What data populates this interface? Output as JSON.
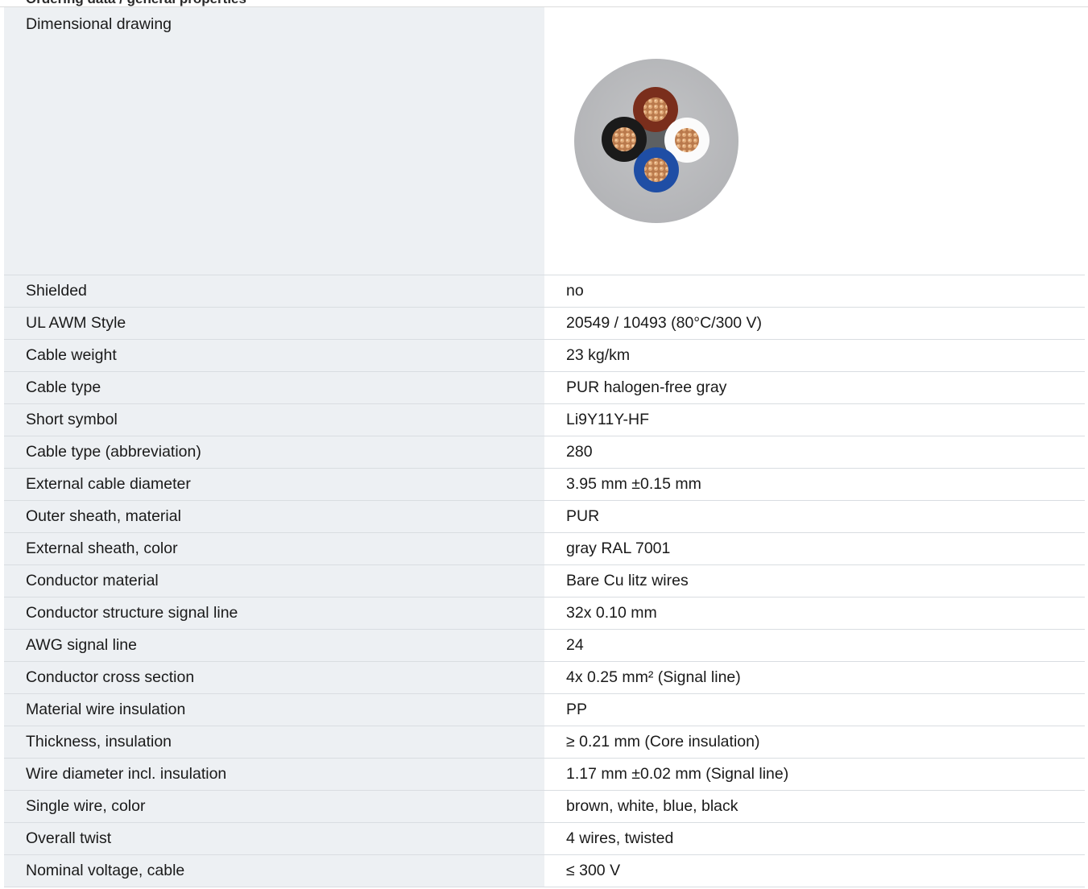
{
  "header": {
    "section_title": "Ordering data / general properties"
  },
  "drawing": {
    "label": "Dimensional drawing",
    "cable_cross_section": {
      "sheath_color": "#bcbdbf",
      "cores": [
        {
          "name": "brown",
          "color": "#7a2e1c"
        },
        {
          "name": "white",
          "color": "#ffffff"
        },
        {
          "name": "blue",
          "color": "#1f4ea5"
        },
        {
          "name": "black",
          "color": "#1a1a1a"
        }
      ],
      "conductor_color": "#c98a5a"
    }
  },
  "rows": [
    {
      "label": "Shielded",
      "value": "no"
    },
    {
      "label": "UL AWM Style",
      "value": "20549 / 10493 (80°C/300 V)"
    },
    {
      "label": "Cable weight",
      "value": "23 kg/km"
    },
    {
      "label": "Cable type",
      "value": "PUR halogen-free gray"
    },
    {
      "label": "Short symbol",
      "value": "Li9Y11Y-HF"
    },
    {
      "label": "Cable type (abbreviation)",
      "value": "280"
    },
    {
      "label": "External cable diameter",
      "value": "3.95 mm ±0.15 mm"
    },
    {
      "label": "Outer sheath, material",
      "value": "PUR"
    },
    {
      "label": "External sheath, color",
      "value": "gray RAL 7001"
    },
    {
      "label": "Conductor material",
      "value": "Bare Cu litz wires"
    },
    {
      "label": "Conductor structure signal line",
      "value": "32x 0.10 mm"
    },
    {
      "label": "AWG signal line",
      "value": "24"
    },
    {
      "label": "Conductor cross section",
      "value": "4x 0.25 mm² (Signal line)"
    },
    {
      "label": "Material wire insulation",
      "value": "PP"
    },
    {
      "label": "Thickness, insulation",
      "value": "≥ 0.21 mm (Core insulation)"
    },
    {
      "label": "Wire diameter incl. insulation",
      "value": "1.17 mm ±0.02 mm (Signal line)"
    },
    {
      "label": "Single wire, color",
      "value": "brown, white, blue, black"
    },
    {
      "label": "Overall twist",
      "value": "4 wires, twisted"
    },
    {
      "label": "Nominal voltage, cable",
      "value": "≤ 300 V"
    }
  ]
}
